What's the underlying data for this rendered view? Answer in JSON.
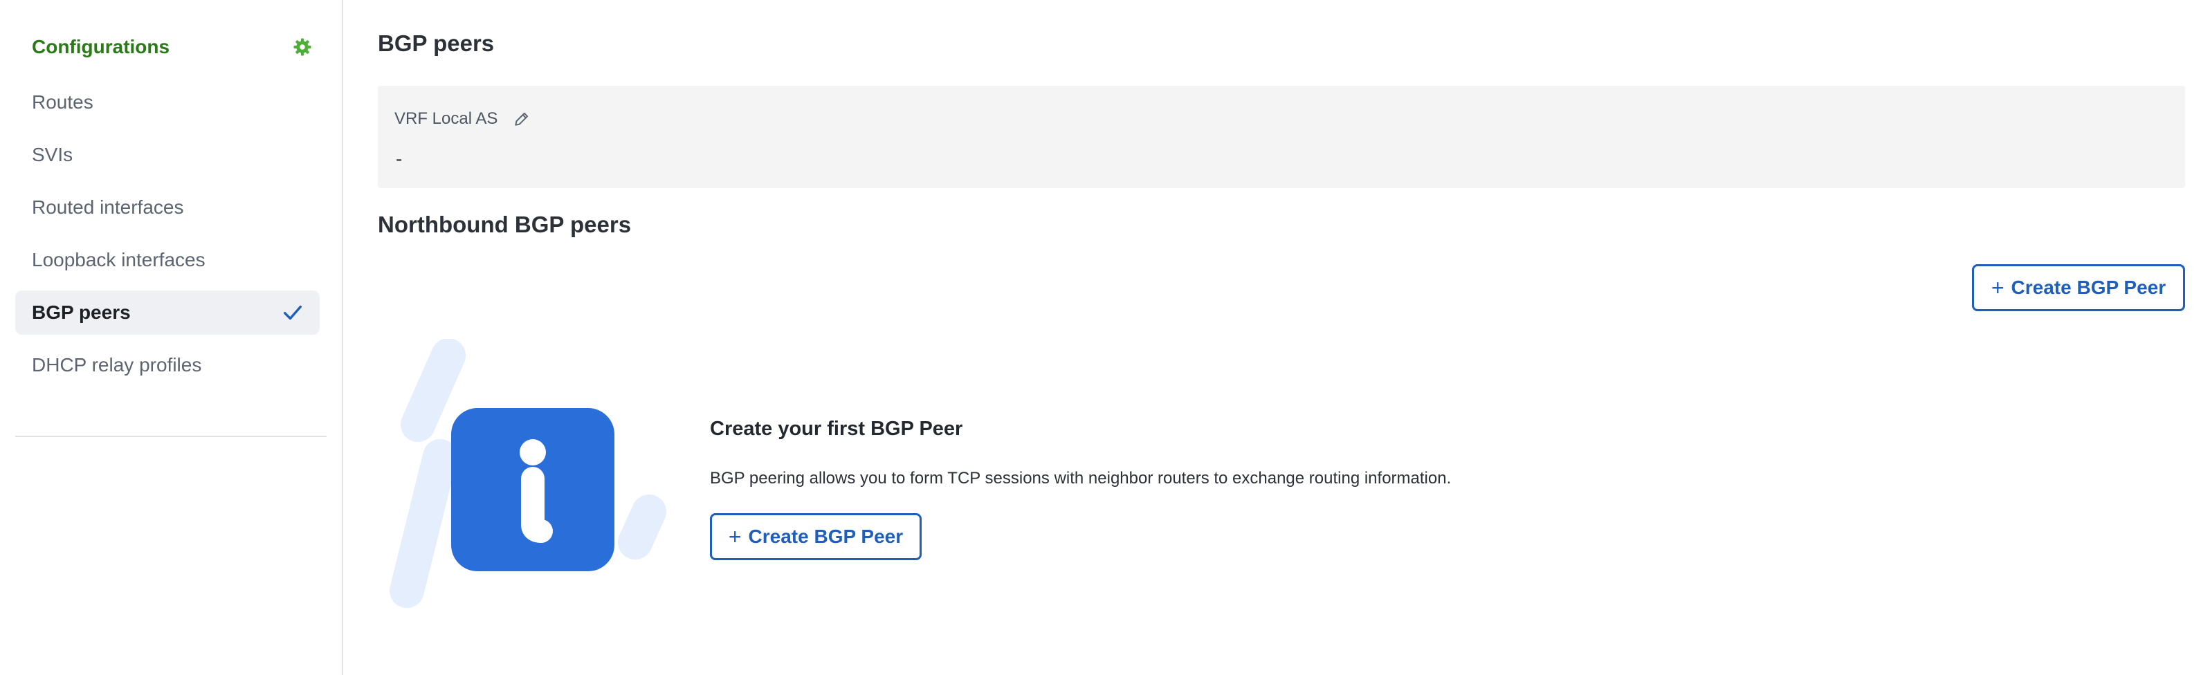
{
  "sidebar": {
    "title": "Configurations",
    "settings_icon": "gear-icon",
    "items": [
      {
        "label": "Routes",
        "active": false
      },
      {
        "label": "SVIs",
        "active": false
      },
      {
        "label": "Routed interfaces",
        "active": false
      },
      {
        "label": "Loopback interfaces",
        "active": false
      },
      {
        "label": "BGP peers",
        "active": true
      },
      {
        "label": "DHCP relay profiles",
        "active": false
      }
    ],
    "active_icon": "checkmark-icon"
  },
  "main": {
    "title": "BGP peers",
    "vrf": {
      "label": "VRF Local AS",
      "edit_icon": "pencil-icon",
      "value": "-"
    },
    "northbound": {
      "title": "Northbound BGP peers",
      "create_button": {
        "icon": "plus",
        "label": "Create BGP Peer"
      },
      "empty_state": {
        "illustration_icon": "info-icon",
        "title": "Create your first BGP Peer",
        "description": "BGP peering allows you to form TCP sessions with neighbor routers to exchange routing information.",
        "button": {
          "icon": "plus",
          "label": "Create BGP Peer"
        }
      }
    }
  },
  "colors": {
    "brand_green": "#2b7a1a",
    "accent_blue": "#1f5fb9",
    "info_blue": "#2a6fd9",
    "light_blue_decor": "#e4eefc",
    "panel_gray": "#f4f4f5"
  }
}
